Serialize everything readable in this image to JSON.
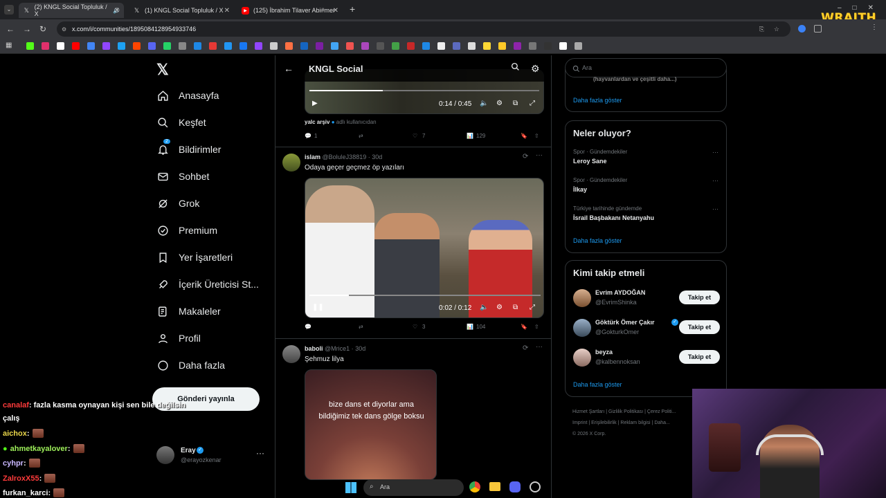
{
  "browser": {
    "tabs": [
      {
        "title": "(2) KNGL Social Topluluk / X",
        "active": true
      },
      {
        "title": "(1) KNGL Social Topluluk / X",
        "active": false
      },
      {
        "title": "(125) İbrahim Tilaver Abi#mem",
        "active": false
      }
    ],
    "url": "x.com/i/communities/1895084128954933746"
  },
  "overlay_logo": "WRAITH",
  "nav": {
    "items": [
      "Anasayfa",
      "Keşfet",
      "Bildirimler",
      "Sohbet",
      "Grok",
      "Premium",
      "Yer İşaretleri",
      "İçerik Üreticisi St...",
      "Makaleler",
      "Profil",
      "Daha fazla"
    ],
    "notif_badge": "2",
    "post_button": "Gönderi yayınla",
    "account": {
      "name": "Eray",
      "handle": "@erayozkenar"
    }
  },
  "community": {
    "title": "KNGL Social"
  },
  "tweets": [
    {
      "video_time": "0:14 / 0:45",
      "credit_name": "yalc arşiv",
      "credit_suffix": "adlı kullanıcıdan",
      "replies": "1",
      "likes": "7",
      "views": "129"
    },
    {
      "name": "islam",
      "handle": "@BoluleJ38819",
      "age": "30d",
      "text": "Odaya geçer geçmez öp yazıları",
      "video_time": "0:02 / 0:12",
      "likes": "3",
      "views": "104"
    },
    {
      "name": "baboli",
      "handle": "@Mrice1",
      "age": "30d",
      "text": "Şehmuz lilya",
      "caption": "bize dans et diyorlar ama bildiğimiz tek dans gölge boksu"
    }
  ],
  "search": {
    "placeholder": "Ara"
  },
  "right": {
    "top_partial": "(hayvanlardan ve çeşitli daha...)",
    "more": "Daha fazla göster",
    "trends_title": "Neler oluyor?",
    "trends": [
      {
        "category": "Spor · Gündemdekiler",
        "title": "Leroy Sane"
      },
      {
        "category": "Spor · Gündemdekiler",
        "title": "İlkay"
      },
      {
        "category": "Türkiye tarihinde gündemde",
        "title": "İsrail Başbakanı Netanyahu"
      }
    ],
    "who_title": "Kimi takip etmeli",
    "who": [
      {
        "name": "Evrim AYDOĞAN",
        "handle": "@EvrimShinka",
        "button": "Takip et"
      },
      {
        "name": "Göktürk Ömer Çakır",
        "handle": "@GokturkOmer",
        "button": "Takip et"
      },
      {
        "name": "beyza",
        "handle": "@kalbennoksan",
        "button": "Takip et"
      }
    ],
    "footer": [
      "Hizmet Şartları",
      "Gizlilik Politikası",
      "Çerez Politi...",
      "Imprint",
      "Erişilebilirlik",
      "Reklam bilgisi",
      "Daha...",
      "© 2026 X Corp."
    ]
  },
  "chat": [
    {
      "user": "canalaf",
      "msg": ": fazla kasma oynayan kişi sen bile değilsin",
      "cont": "çalış",
      "color": "#ff3b3b"
    },
    {
      "user": "aichox",
      "msg": " :",
      "color": "#e9d64a"
    },
    {
      "user": "ahmetkayalover",
      "msg": " :",
      "color": "#9ef05a"
    },
    {
      "user": "cyhpr",
      "msg": " :",
      "color": "#c9b7ff"
    },
    {
      "user": "ZalroxX55",
      "msg": " :",
      "color": "#ff3b3b"
    },
    {
      "user": "furkan_karci",
      "msg": " :",
      "color": "#ffffff"
    }
  ],
  "taskbar": {
    "search": "Ara"
  }
}
